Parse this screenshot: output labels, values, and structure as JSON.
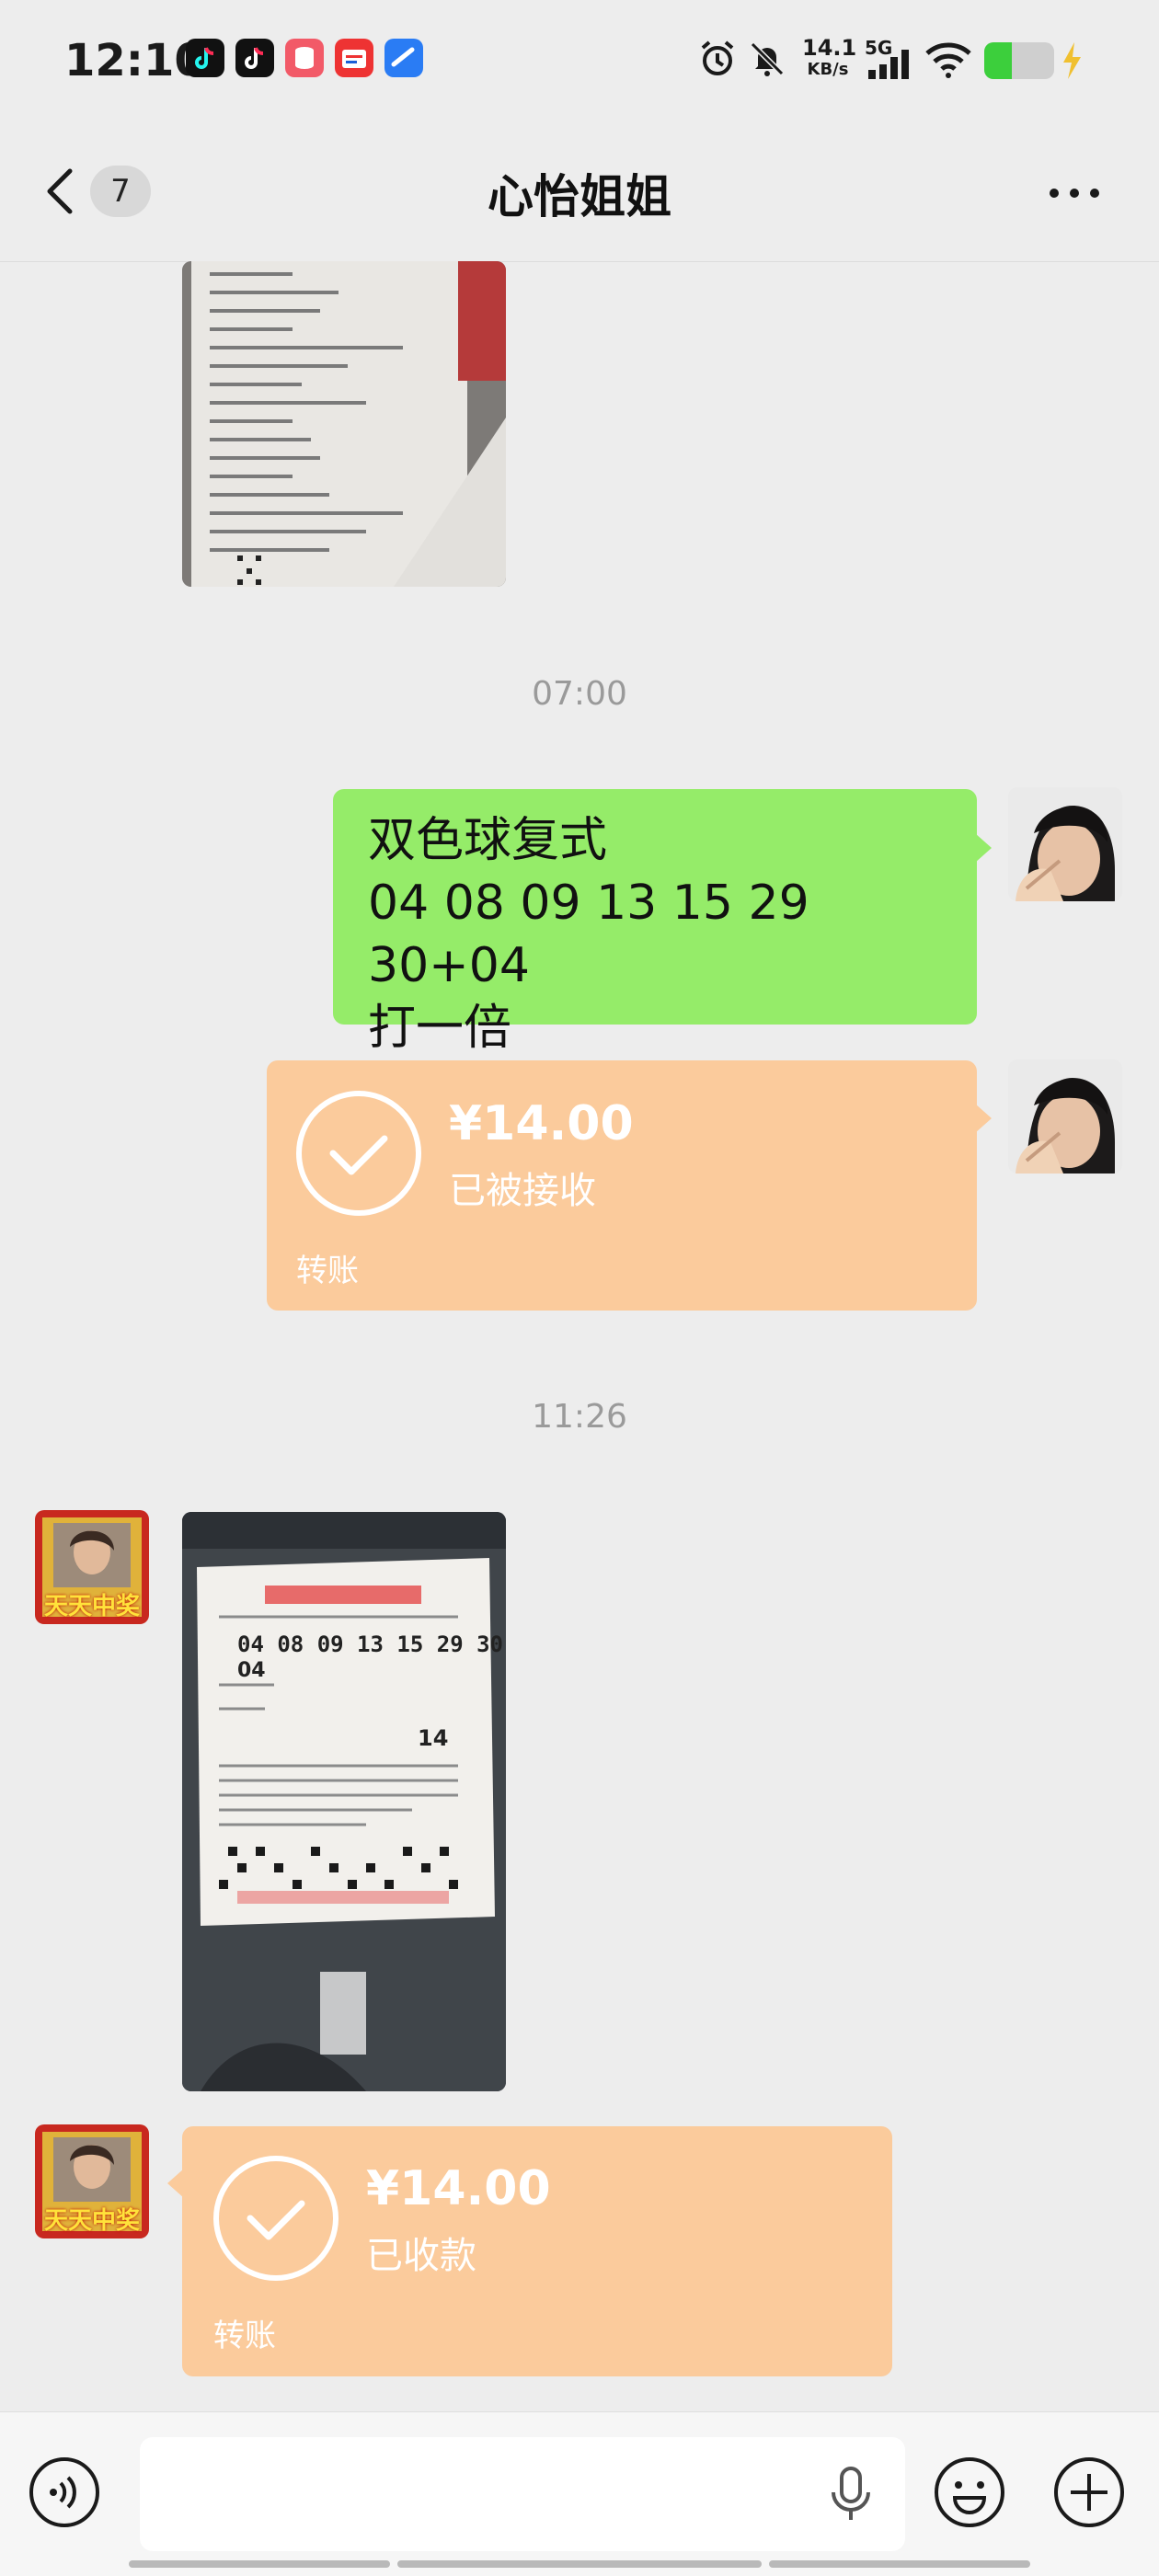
{
  "status_bar": {
    "time": "12:10",
    "net_speed_top": "14.1",
    "net_speed_bottom": "KB/s",
    "network": "5G"
  },
  "header": {
    "unread_count": "7",
    "title": "心怡姐姐"
  },
  "messages": {
    "time_1": "07:00",
    "text_message": "双色球复式\n04 08 09 13 15 29 30+04\n打一倍",
    "transfer_sent": {
      "amount": "¥14.00",
      "status": "已被接收",
      "label": "转账"
    },
    "time_2": "11:26",
    "transfer_received": {
      "amount": "¥14.00",
      "status": "已收款",
      "label": "转账"
    }
  },
  "ticket_photo": {
    "numbers": "04 08 09 13 15 29 30",
    "blue": "04",
    "total": "14"
  },
  "contact_avatar_text": "天天中奖",
  "colors": {
    "green_bubble": "#95ec69",
    "transfer_bubble": "#fbcb9c",
    "background": "#ededed"
  },
  "icons": [
    "back-arrow-icon",
    "more-icon",
    "voice-icon",
    "mic-icon",
    "emoji-icon",
    "plus-icon"
  ]
}
